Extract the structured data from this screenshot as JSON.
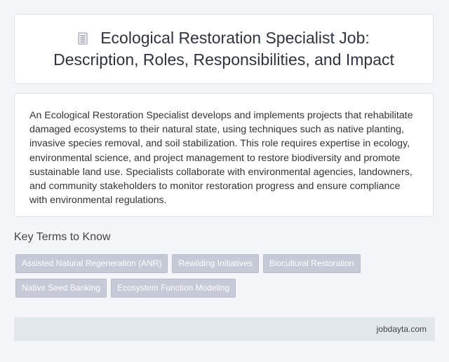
{
  "header": {
    "icon": "document-icon",
    "title": "Ecological Restoration Specialist Job: Description, Roles, Responsibilities, and Impact"
  },
  "description": {
    "text": "An Ecological Restoration Specialist develops and implements projects that rehabilitate damaged ecosystems to their natural state, using techniques such as native planting, invasive species removal, and soil stabilization. This role requires expertise in ecology, environmental science, and project management to restore biodiversity and promote sustainable land use. Specialists collaborate with environmental agencies, landowners, and community stakeholders to monitor restoration progress and ensure compliance with environmental regulations."
  },
  "key_terms": {
    "heading": "Key Terms to Know",
    "tags": [
      "Assisted Natural Regeneration (ANR)",
      "Rewilding Initiatives",
      "Biocultural Restoration",
      "Native Seed Banking",
      "Ecosystem Function Modeling"
    ]
  },
  "footer": {
    "site": "jobdayta.com"
  }
}
